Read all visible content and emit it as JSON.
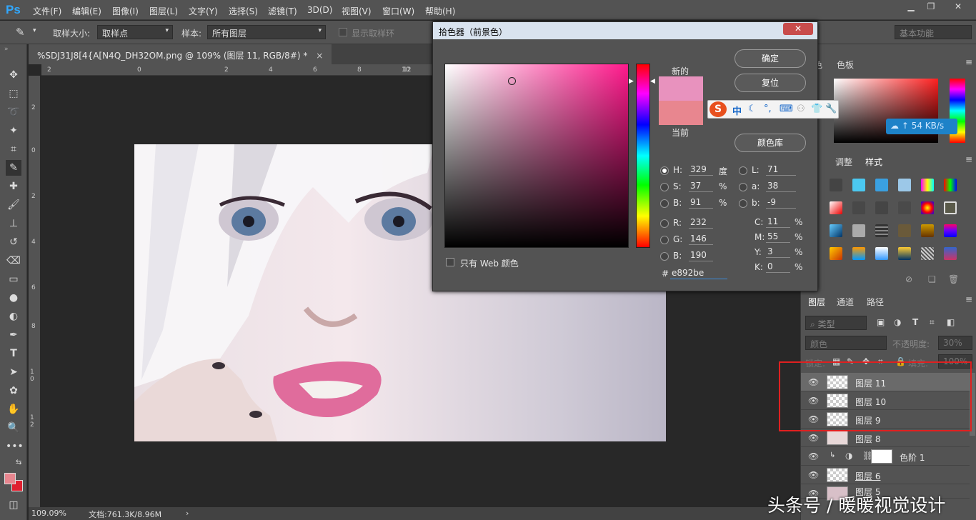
{
  "menubar": {
    "logo": "Ps",
    "items": [
      "文件(F)",
      "编辑(E)",
      "图像(I)",
      "图层(L)",
      "文字(Y)",
      "选择(S)",
      "滤镜(T)",
      "3D(D)",
      "视图(V)",
      "窗口(W)",
      "帮助(H)"
    ]
  },
  "options": {
    "sample_size_label": "取样大小:",
    "sample_size_value": "取样点",
    "sample_label": "样本:",
    "sample_value": "所有图层",
    "show_ring_label": "显示取样环",
    "workspace": "基本功能"
  },
  "document": {
    "tab_title": "%SDJ31J8[4{A[N4Q_DH32OM.png @ 109% (图层 11, RGB/8#) *",
    "close": "×"
  },
  "ruler": {
    "top": [
      "2",
      "0",
      "2",
      "4",
      "6",
      "8",
      "10",
      "12"
    ],
    "left": [
      "2",
      "0",
      "2",
      "4",
      "6",
      "8",
      "1 0",
      "1 2"
    ]
  },
  "status": {
    "zoom": "109.09%",
    "doc_info": "文档:761.3K/8.96M"
  },
  "picker": {
    "title": "拾色器（前景色）",
    "new_label": "新的",
    "current_label": "当前",
    "new_color": "#e892be",
    "current_color": "#e8868f",
    "ok": "确定",
    "reset": "复位",
    "color_library": "颜色库",
    "web_only": "只有 Web 颜色",
    "H": "329",
    "H_unit": "度",
    "S": "37",
    "S_unit": "%",
    "Bv": "91",
    "B_unit": "%",
    "R": "232",
    "G": "146",
    "Bc": "190",
    "L": "71",
    "a": "38",
    "b": "-9",
    "C": "11",
    "M": "55",
    "Y": "3",
    "K": "0",
    "pct": "%",
    "hex_label": "#",
    "hex": "e892be",
    "labels": {
      "H": "H:",
      "S": "S:",
      "B": "B:",
      "R": "R:",
      "G": "G:",
      "B2": "B:",
      "L": "L:",
      "a": "a:",
      "b": "b:",
      "C": "C:",
      "M": "M:",
      "Y": "Y:",
      "K": "K:"
    }
  },
  "ime": {
    "logo": "S",
    "mode": "中",
    "netspeed": "54 KB/s"
  },
  "panels": {
    "color_tab": "色",
    "swatches_tab": "色板",
    "adjust_tab": "调整",
    "styles_tab": "样式",
    "layers_tab": "图层",
    "channels_tab": "通道",
    "paths_tab": "路径",
    "kind_filter": "类型",
    "blend_mode": "颜色",
    "opacity_label": "不透明度:",
    "opacity_value": "30%",
    "lock_label": "锁定:",
    "fill_label": "填充:",
    "fill_value": "100%"
  },
  "layers": [
    {
      "name": "图层 11",
      "selected": true
    },
    {
      "name": "图层 10",
      "selected": false
    },
    {
      "name": "图层 9",
      "selected": false
    },
    {
      "name": "图层 8",
      "selected": false
    },
    {
      "name": "色阶 1",
      "selected": false
    },
    {
      "name": "图层 6",
      "selected": false
    },
    {
      "name": "图层 5",
      "selected": false
    }
  ],
  "watermark": "头条号 / 暖暖视觉设计"
}
